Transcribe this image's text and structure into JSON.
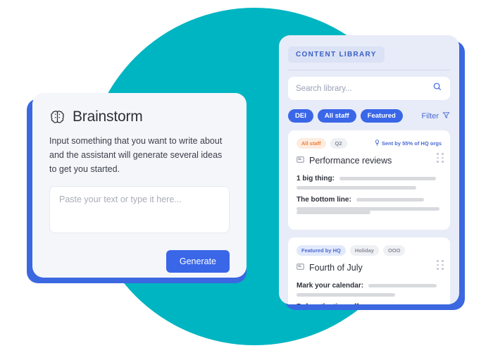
{
  "colors": {
    "teal_circle": "#00b5c2",
    "blue_shadow": "#3b68e0",
    "accent_blue": "#3a66e8",
    "panel_left_bg": "#f4f6fa",
    "panel_right_bg": "#e8ecf8",
    "tag_orange": "#f08033",
    "skeleton_gray": "#d8dade"
  },
  "brainstorm": {
    "icon": "brain-icon",
    "title": "Brainstorm",
    "description": "Input something that you want to write about and the assistant will generate several ideas to get you started.",
    "textarea_placeholder": "Paste your text or type it here...",
    "textarea_value": "",
    "generate_label": "Generate"
  },
  "library": {
    "header_chip": "CONTENT LIBRARY",
    "search": {
      "placeholder": "Search library...",
      "value": "",
      "icon": "search-icon"
    },
    "filters": {
      "pills": [
        "DEI",
        "All staff",
        "Featured"
      ],
      "filter_label": "Filter",
      "filter_icon": "funnel-icon"
    },
    "cards": [
      {
        "tags": [
          {
            "label": "All staff",
            "style": "orange"
          },
          {
            "label": "Q2",
            "style": "gray"
          }
        ],
        "sent_note": "Sent by 55% of HQ orgs",
        "sent_icon": "lightbulb-icon",
        "doc_icon": "document-icon",
        "title": "Performance reviews",
        "drag_icon": "drag-handle-icon",
        "fields": [
          {
            "label": "1 big thing:",
            "inline_bar_width": 137,
            "bars": [
              170
            ]
          },
          {
            "label": "The bottom line:",
            "inline_bar_width": 96,
            "bars": [
              203,
              105
            ]
          }
        ]
      },
      {
        "tags": [
          {
            "label": "Featured by HQ",
            "style": "blue"
          },
          {
            "label": "Holiday",
            "style": "gray"
          },
          {
            "label": "OOO",
            "style": "gray"
          }
        ],
        "sent_note": "",
        "sent_icon": "",
        "doc_icon": "document-icon",
        "title": "Fourth of July",
        "drag_icon": "drag-handle-icon",
        "fields": [
          {
            "label": "Mark your calendar:",
            "inline_bar_width": 97,
            "bars": [
              140
            ]
          },
          {
            "label": "Before the time off:",
            "inline_bar_width": 124,
            "bars": [
              189
            ]
          }
        ]
      }
    ]
  }
}
